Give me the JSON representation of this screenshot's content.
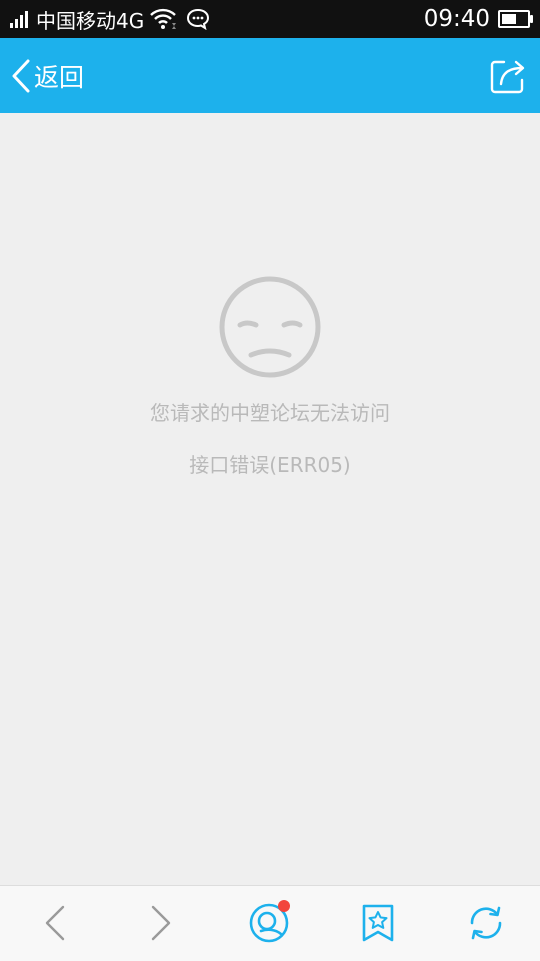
{
  "status_bar": {
    "carrier": "中国移动4G",
    "time": "09:40",
    "battery_level": 0.6
  },
  "header": {
    "back_label": "返回"
  },
  "error": {
    "message": "您请求的中塑论坛无法访问",
    "code": "接口错误(ERR05)"
  },
  "bottom_bar": {
    "icons": [
      "back-icon",
      "forward-icon",
      "qzone-icon",
      "bookmark-star-icon",
      "refresh-icon"
    ],
    "has_notification_badge": true
  },
  "colors": {
    "accent": "#1db1ec",
    "status_bar_bg": "#111111",
    "content_bg": "#efefef",
    "muted_text": "#b9b9b9",
    "badge": "#f2453c"
  }
}
